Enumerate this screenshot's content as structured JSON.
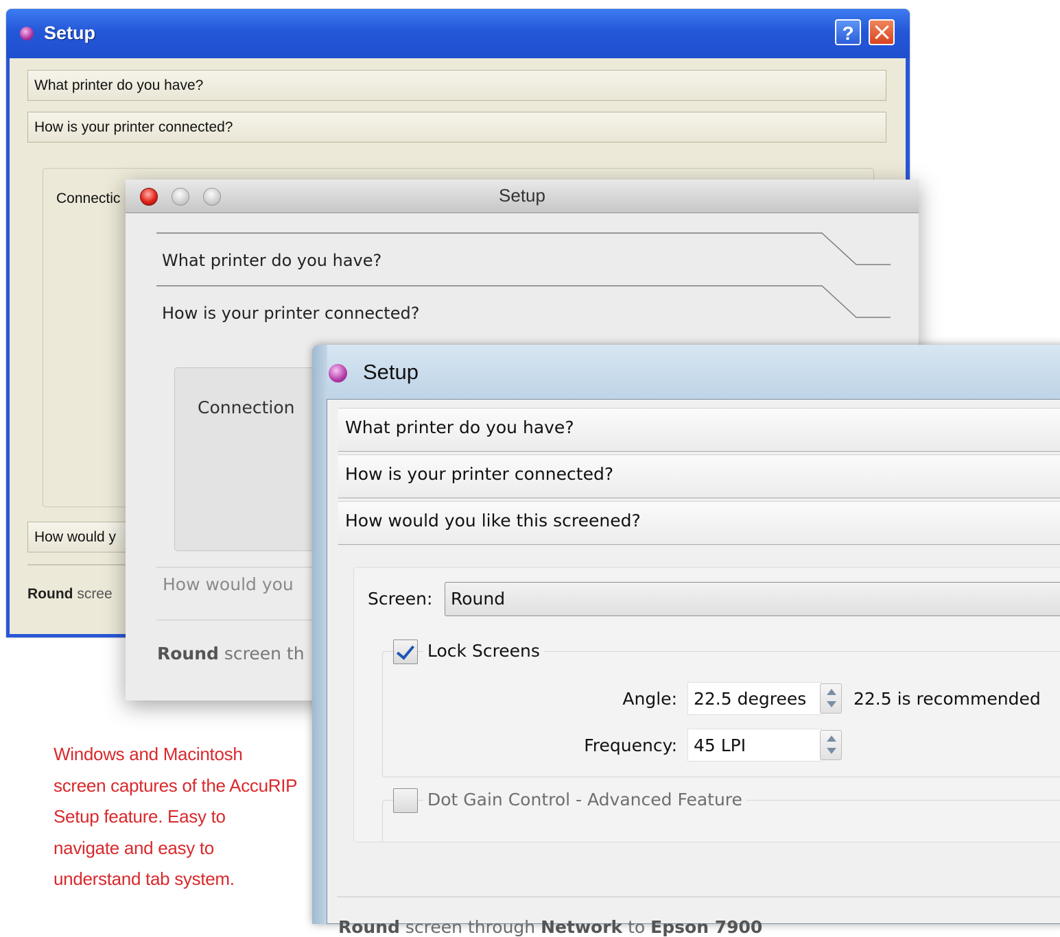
{
  "windows_xp": {
    "title": "Setup",
    "help_label": "?",
    "rows": [
      "What printer do you have?",
      "How is your printer connected?"
    ],
    "connection_label": "Connectic",
    "row3_partial": "How would y",
    "status_bold": "Round",
    "status_rest": " scree"
  },
  "mac": {
    "title": "Setup",
    "rows": [
      "What printer do you have?",
      "How is your printer connected?"
    ],
    "connection_label": "Connection",
    "row3_partial": "How would you",
    "status_bold": "Round",
    "status_rest": " screen th"
  },
  "vista": {
    "title": "Setup",
    "rows": [
      "What printer do you have?",
      "How is your printer connected?",
      "How would you like this screened?"
    ],
    "screen_label": "Screen:",
    "screen_value": "Round",
    "lock_screens": {
      "label": "Lock Screens",
      "checked": true
    },
    "angle": {
      "label": "Angle:",
      "value": "22.5 degrees",
      "note": "22.5 is recommended"
    },
    "frequency": {
      "label": "Frequency:",
      "value": "45 LPI"
    },
    "dot_gain": {
      "label": "Dot Gain Control - Advanced Feature",
      "checked": false
    },
    "status": {
      "b1": "Round",
      "t1": " screen through ",
      "b2": "Network",
      "t2": " to ",
      "b3": "Epson 7900"
    }
  },
  "caption": {
    "lines": [
      "Windows and Macintosh",
      "screen captures of the AccuRIP",
      "Setup feature.  Easy to",
      "navigate and easy to",
      "understand tab system."
    ]
  },
  "colors": {
    "caption": "#d9292c",
    "xp_frame": "#2a56d8",
    "mac_close": "#e2231a"
  }
}
